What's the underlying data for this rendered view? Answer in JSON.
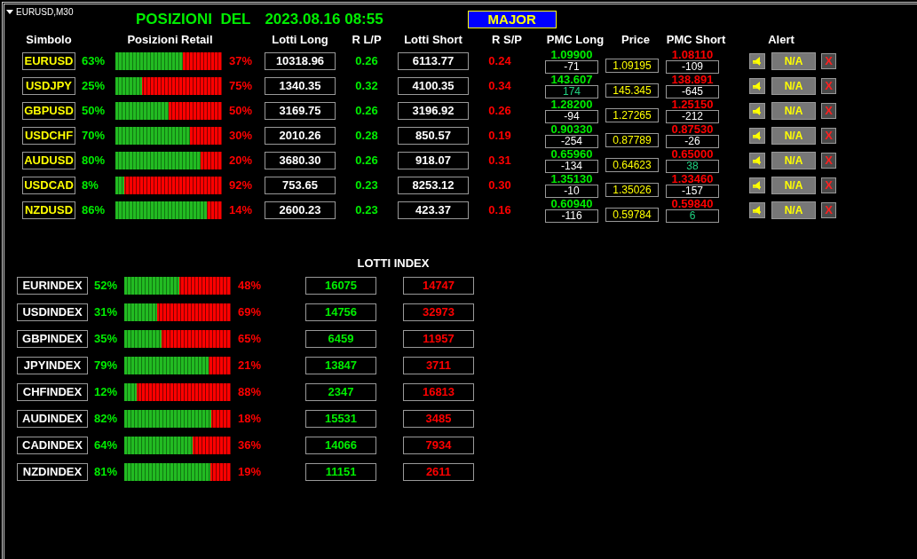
{
  "chart_label": "EURUSD,M30",
  "title": "POSIZIONI  DEL",
  "timestamp": "2023.08.16 08:55",
  "group_button": "MAJOR",
  "major": {
    "columns": [
      "Simbolo",
      "Posizioni Retail",
      "Lotti Long",
      "R L/P",
      "Lotti Short",
      "R S/P",
      "PMC Long",
      "Price",
      "PMC Short",
      "Alert"
    ],
    "rows": [
      {
        "symbol": "EURUSD",
        "long_pct": "63%",
        "level": 0.63,
        "short_pct": "37%",
        "lotti_long": "10318.96",
        "r_lp": "0.26",
        "lotti_short": "6113.77",
        "r_sp": "0.24",
        "pmc_long": {
          "price": "1.09900",
          "diff": "-71",
          "color": "#ffffff"
        },
        "price": "1.09195",
        "pmc_short": {
          "price": "1.08110",
          "diff": "-109",
          "color": "#ffffff"
        },
        "alert": "N/A",
        "close": "X"
      },
      {
        "symbol": "USDJPY",
        "long_pct": "25%",
        "level": 0.25,
        "short_pct": "75%",
        "lotti_long": "1340.35",
        "r_lp": "0.32",
        "lotti_short": "4100.35",
        "r_sp": "0.34",
        "pmc_long": {
          "price": "143.607",
          "diff": "174",
          "color": "#20d080"
        },
        "price": "145.345",
        "pmc_short": {
          "price": "138.891",
          "diff": "-645",
          "color": "#ffffff"
        },
        "alert": "N/A",
        "close": "X"
      },
      {
        "symbol": "GBPUSD",
        "long_pct": "50%",
        "level": 0.5,
        "short_pct": "50%",
        "lotti_long": "3169.75",
        "r_lp": "0.26",
        "lotti_short": "3196.92",
        "r_sp": "0.26",
        "pmc_long": {
          "price": "1.28200",
          "diff": "-94",
          "color": "#ffffff"
        },
        "price": "1.27265",
        "pmc_short": {
          "price": "1.25150",
          "diff": "-212",
          "color": "#ffffff"
        },
        "alert": "N/A",
        "close": "X"
      },
      {
        "symbol": "USDCHF",
        "long_pct": "70%",
        "level": 0.7,
        "short_pct": "30%",
        "lotti_long": "2010.26",
        "r_lp": "0.28",
        "lotti_short": "850.57",
        "r_sp": "0.19",
        "pmc_long": {
          "price": "0.90330",
          "diff": "-254",
          "color": "#ffffff"
        },
        "price": "0.87789",
        "pmc_short": {
          "price": "0.87530",
          "diff": "-26",
          "color": "#ffffff"
        },
        "alert": "N/A",
        "close": "X"
      },
      {
        "symbol": "AUDUSD",
        "long_pct": "80%",
        "level": 0.8,
        "short_pct": "20%",
        "lotti_long": "3680.30",
        "r_lp": "0.26",
        "lotti_short": "918.07",
        "r_sp": "0.31",
        "pmc_long": {
          "price": "0.65960",
          "diff": "-134",
          "color": "#ffffff"
        },
        "price": "0.64623",
        "pmc_short": {
          "price": "0.65000",
          "diff": "38",
          "color": "#20d080"
        },
        "alert": "N/A",
        "close": "X"
      },
      {
        "symbol": "USDCAD",
        "long_pct": "8%",
        "level": 0.08,
        "short_pct": "92%",
        "lotti_long": "753.65",
        "r_lp": "0.23",
        "lotti_short": "8253.12",
        "r_sp": "0.30",
        "pmc_long": {
          "price": "1.35130",
          "diff": "-10",
          "color": "#ffffff"
        },
        "price": "1.35026",
        "pmc_short": {
          "price": "1.33460",
          "diff": "-157",
          "color": "#ffffff"
        },
        "alert": "N/A",
        "close": "X"
      },
      {
        "symbol": "NZDUSD",
        "long_pct": "86%",
        "level": 0.86,
        "short_pct": "14%",
        "lotti_long": "2600.23",
        "r_lp": "0.23",
        "lotti_short": "423.37",
        "r_sp": "0.16",
        "pmc_long": {
          "price": "0.60940",
          "diff": "-116",
          "color": "#ffffff"
        },
        "price": "0.59784",
        "pmc_short": {
          "price": "0.59840",
          "diff": "6",
          "color": "#20d080"
        },
        "alert": "N/A",
        "close": "X"
      }
    ]
  },
  "index": {
    "title": "LOTTI INDEX",
    "rows": [
      {
        "name": "EURINDEX",
        "long_pct": "52%",
        "level": 0.52,
        "short_pct": "48%",
        "lotti_long": "16075",
        "lotti_short": "14747"
      },
      {
        "name": "USDINDEX",
        "long_pct": "31%",
        "level": 0.31,
        "short_pct": "69%",
        "lotti_long": "14756",
        "lotti_short": "32973"
      },
      {
        "name": "GBPINDEX",
        "long_pct": "35%",
        "level": 0.35,
        "short_pct": "65%",
        "lotti_long": "6459",
        "lotti_short": "11957"
      },
      {
        "name": "JPYINDEX",
        "long_pct": "79%",
        "level": 0.79,
        "short_pct": "21%",
        "lotti_long": "13847",
        "lotti_short": "3711"
      },
      {
        "name": "CHFINDEX",
        "long_pct": "12%",
        "level": 0.12,
        "short_pct": "88%",
        "lotti_long": "2347",
        "lotti_short": "16813"
      },
      {
        "name": "AUDINDEX",
        "long_pct": "82%",
        "level": 0.82,
        "short_pct": "18%",
        "lotti_long": "15531",
        "lotti_short": "3485"
      },
      {
        "name": "CADINDEX",
        "long_pct": "64%",
        "level": 0.64,
        "short_pct": "36%",
        "lotti_long": "14066",
        "lotti_short": "7934"
      },
      {
        "name": "NZDINDEX",
        "long_pct": "81%",
        "level": 0.81,
        "short_pct": "19%",
        "lotti_long": "11151",
        "lotti_short": "2611"
      }
    ]
  }
}
